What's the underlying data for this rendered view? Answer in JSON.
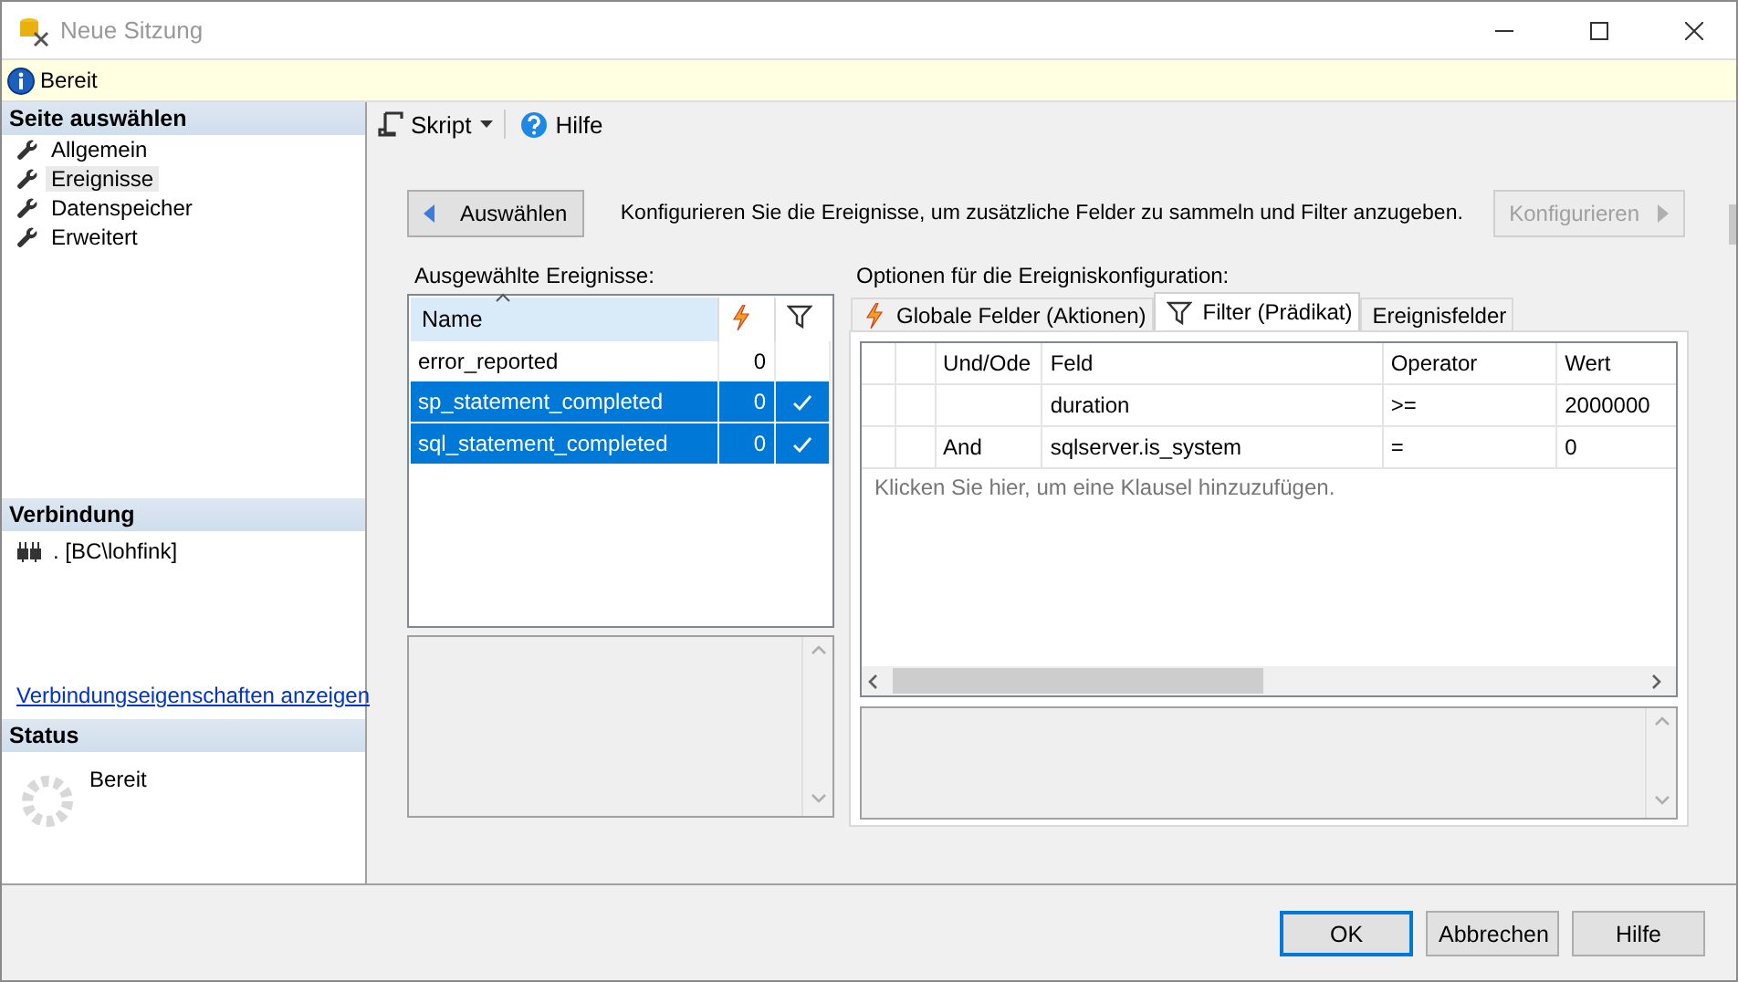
{
  "window": {
    "title": "Neue Sitzung"
  },
  "info_bar": {
    "text": "Bereit"
  },
  "sidebar": {
    "header": "Seite auswählen",
    "pages": [
      {
        "label": "Allgemein",
        "selected": false
      },
      {
        "label": "Ereignisse",
        "selected": true
      },
      {
        "label": "Datenspeicher",
        "selected": false
      },
      {
        "label": "Erweitert",
        "selected": false
      }
    ],
    "connection": {
      "header": "Verbindung",
      "server": ". [BC\\lohfink]",
      "link": "Verbindungseigenschaften anzeigen"
    },
    "status": {
      "header": "Status",
      "text": "Bereit"
    }
  },
  "toolbar": {
    "script": "Skript",
    "help": "Hilfe"
  },
  "select_button": "Auswählen",
  "description": "Konfigurieren Sie die Ereignisse, um zusätzliche Felder zu sammeln und Filter anzugeben.",
  "configure_button": {
    "label": "Konfigurieren",
    "disabled": true
  },
  "selected_events": {
    "label": "Ausgewählte Ereignisse:",
    "column": "Name",
    "rows": [
      {
        "name": "error_reported",
        "actions": "0",
        "filter": false,
        "selected": false
      },
      {
        "name": "sp_statement_completed",
        "actions": "0",
        "filter": true,
        "selected": true
      },
      {
        "name": "sql_statement_completed",
        "actions": "0",
        "filter": true,
        "selected": true
      }
    ]
  },
  "options": {
    "label": "Optionen für die Ereigniskonfiguration:",
    "tabs": [
      {
        "label": "Globale Felder (Aktionen)",
        "kind": "actions",
        "selected": false
      },
      {
        "label": "Filter (Prädikat)",
        "kind": "filter",
        "selected": true
      },
      {
        "label": "Ereignisfelder",
        "kind": "plain",
        "selected": false
      }
    ],
    "filter_table": {
      "columns": [
        "Und/Ode",
        "Feld",
        "Operator",
        "Wert"
      ],
      "rows": [
        [
          "",
          "duration",
          ">=",
          "2000000"
        ],
        [
          "And",
          "sqlserver.is_system",
          "=",
          "0"
        ]
      ],
      "add_hint": "Klicken Sie hier, um eine Klausel hinzuzufügen."
    }
  },
  "buttons": [
    {
      "label": "OK",
      "default": true
    },
    {
      "label": "Abbrechen",
      "default": false
    },
    {
      "label": "Hilfe",
      "default": false
    }
  ]
}
